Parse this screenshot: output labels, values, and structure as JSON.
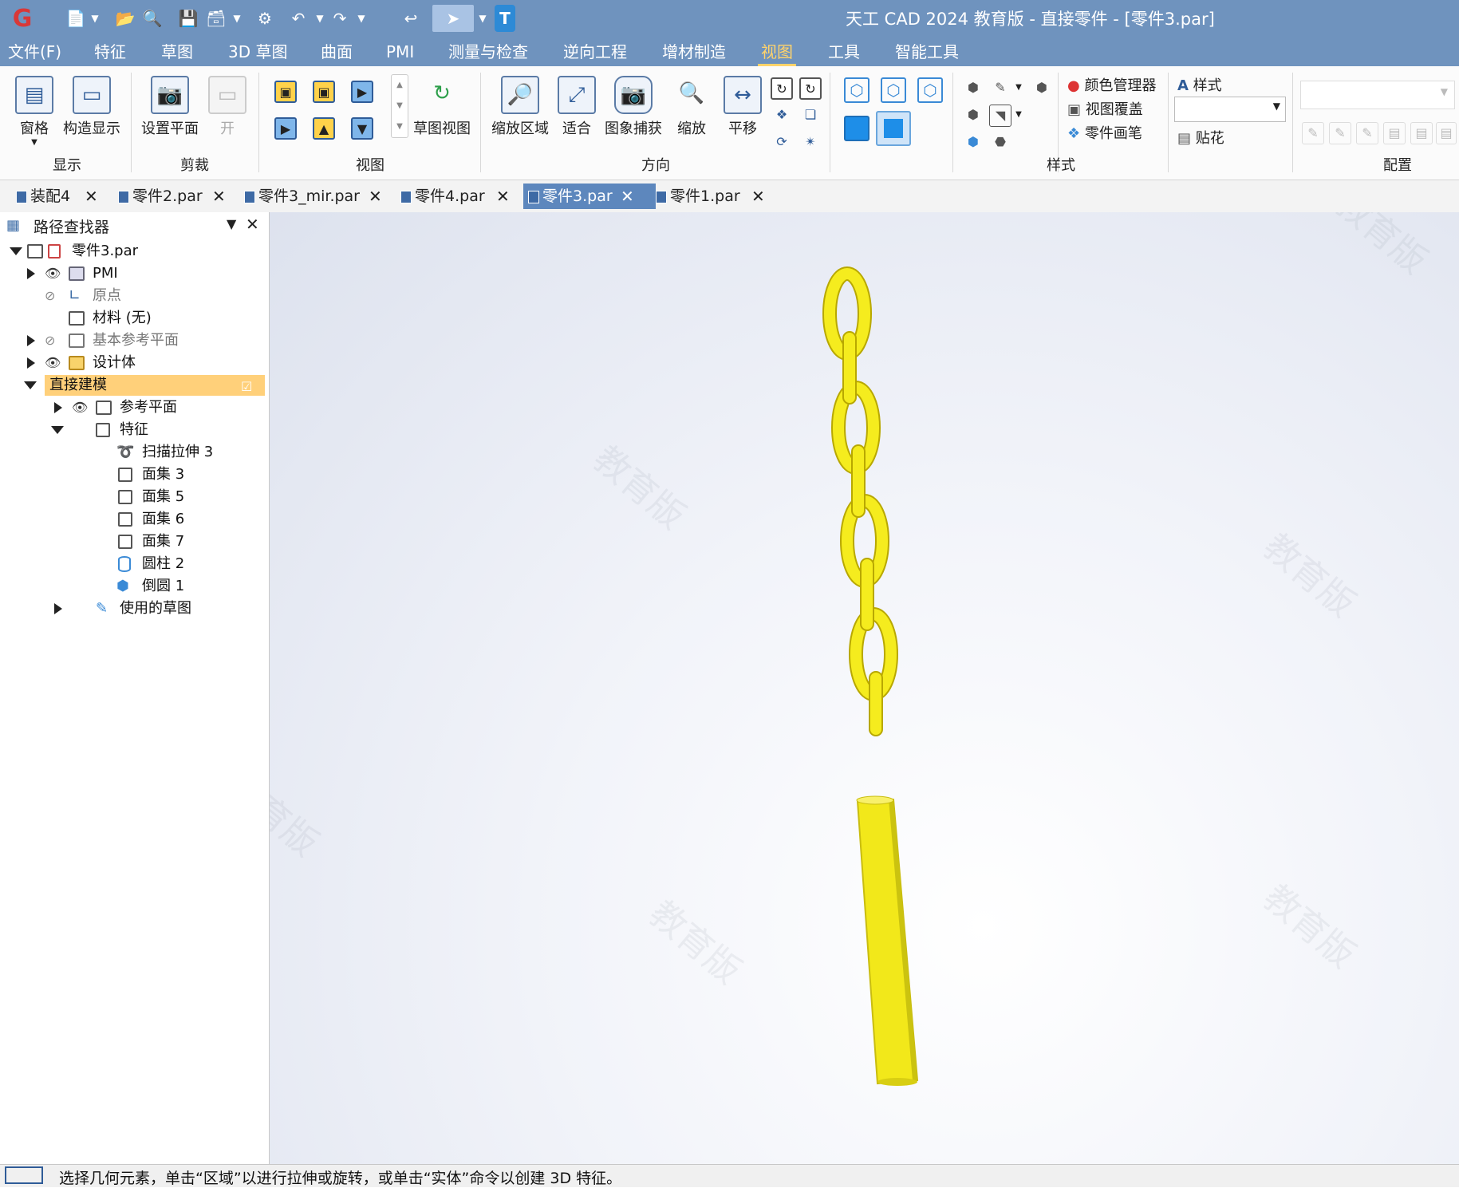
{
  "app": {
    "title": "天工 CAD 2024 教育版 - 直接零件 - [零件3.par]"
  },
  "menu": {
    "items": [
      "文件(F)",
      "特征",
      "草图",
      "3D 草图",
      "曲面",
      "PMI",
      "测量与检查",
      "逆向工程",
      "增材制造",
      "视图",
      "工具",
      "智能工具"
    ],
    "active": "视图"
  },
  "ribbon": {
    "display": {
      "window_label": "窗格",
      "construct_label": "构造显示",
      "group": "显示"
    },
    "clip": {
      "set_plane_label": "设置平面",
      "open_label": "开",
      "group": "剪裁"
    },
    "view": {
      "sketch_view_label": "草图视图",
      "group": "视图"
    },
    "orient": {
      "zoom_area_label": "缩放区域",
      "fit_label": "适合",
      "capture_label": "图象捕获",
      "zoom_label": "缩放",
      "pan_label": "平移",
      "group": "方向"
    },
    "style": {
      "color_mgr_label": "颜色管理器",
      "view_overlay_label": "视图覆盖",
      "part_painter_label": "零件画笔",
      "styles_label": "样式",
      "decal_label": "贴花",
      "group": "样式"
    },
    "config": {
      "group": "配置"
    }
  },
  "tabs": [
    {
      "label": "装配4",
      "active": false
    },
    {
      "label": "零件2.par",
      "active": false
    },
    {
      "label": "零件3_mir.par",
      "active": false
    },
    {
      "label": "零件4.par",
      "active": false
    },
    {
      "label": "零件3.par",
      "active": true
    },
    {
      "label": "零件1.par",
      "active": false
    }
  ],
  "pathfinder": {
    "title": "路径查找器",
    "root": "零件3.par",
    "pmi": "PMI",
    "origin": "原点",
    "material": "材料 (无)",
    "base_planes": "基本参考平面",
    "design_body": "设计体",
    "direct_modeling": "直接建模",
    "ref_planes": "参考平面",
    "features": "特征",
    "feature_items": [
      "扫描拉伸 3",
      "面集 3",
      "面集 5",
      "面集 6",
      "面集 7",
      "圆柱 2",
      "倒圆 1"
    ],
    "used_sketches": "使用的草图"
  },
  "viewport": {
    "watermark": "教育版",
    "model_color": "#f5ec1e"
  },
  "status": {
    "text": "选择几何元素，单击“区域”以进行拉伸或旋转，或单击“实体”命令以创建 3D 特征。"
  }
}
